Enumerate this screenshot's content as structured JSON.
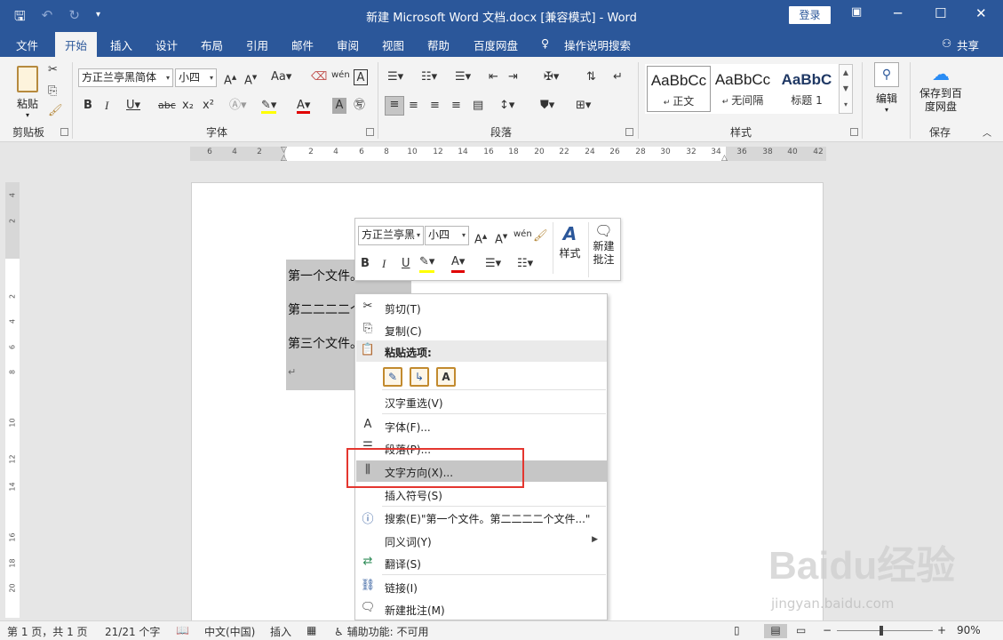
{
  "titlebar": {
    "title": "新建 Microsoft Word 文档.docx [兼容模式] - Word",
    "login": "登录"
  },
  "tabs": [
    "文件",
    "开始",
    "插入",
    "设计",
    "布局",
    "引用",
    "邮件",
    "审阅",
    "视图",
    "帮助",
    "百度网盘"
  ],
  "tell_me": "操作说明搜索",
  "share": "共享",
  "ribbon": {
    "clipboard": {
      "paste": "粘贴",
      "label": "剪贴板"
    },
    "font": {
      "font_name": "方正兰亭黑简体",
      "font_size": "小四",
      "label": "字体"
    },
    "paragraph": {
      "label": "段落"
    },
    "styles": {
      "label": "样式",
      "items": [
        {
          "preview": "AaBbCc",
          "name": "正文"
        },
        {
          "preview": "AaBbCc",
          "name": "无间隔"
        },
        {
          "preview": "AaBbC",
          "name": "标题 1"
        }
      ]
    },
    "editing": {
      "label": "编辑"
    },
    "save": {
      "button": "保存到百度网盘",
      "label": "保存"
    }
  },
  "ruler": {
    "ticks": [
      "6",
      "4",
      "2",
      "",
      "2",
      "4",
      "6",
      "8",
      "10",
      "12",
      "14",
      "16",
      "18",
      "20",
      "22",
      "24",
      "26",
      "28",
      "30",
      "32",
      "34",
      "36",
      "38",
      "40",
      "42"
    ]
  },
  "vruler": {
    "ticks": [
      "4",
      "2",
      "",
      "2",
      "4",
      "6",
      "8",
      "10",
      "12",
      "14",
      "16",
      "18",
      "20"
    ]
  },
  "document": {
    "lines": [
      "第一个文件。",
      "第二二二二个文件。",
      "第三个文件。"
    ],
    "paragraph_mark": "↵"
  },
  "minibar": {
    "font_name": "方正兰亭黑",
    "font_size": "小四",
    "styles": "样式",
    "new_comment": "新建批注"
  },
  "context_menu": {
    "items": [
      {
        "label": "剪切(T)",
        "icon": "scissors-icon"
      },
      {
        "label": "复制(C)",
        "icon": "copy-icon"
      },
      {
        "label": "粘贴选项:",
        "icon": "paste-icon"
      },
      {
        "label": "汉字重选(V)",
        "icon": ""
      },
      {
        "label": "字体(F)...",
        "icon": "font-icon"
      },
      {
        "label": "段落(P)...",
        "icon": "paragraph-icon"
      },
      {
        "label": "文字方向(X)...",
        "icon": "text-direction-icon"
      },
      {
        "label": "插入符号(S)",
        "icon": ""
      },
      {
        "label": "搜索(E)\"第一个文件。第二二二二个文件...\"",
        "icon": "search-info-icon"
      },
      {
        "label": "同义词(Y)",
        "icon": ""
      },
      {
        "label": "翻译(S)",
        "icon": "translate-icon"
      },
      {
        "label": "链接(I)",
        "icon": "link-icon"
      },
      {
        "label": "新建批注(M)",
        "icon": "new-comment-icon"
      }
    ]
  },
  "statusbar": {
    "page": "第 1 页，共 1 页",
    "words": "21/21 个字",
    "language": "中文(中国)",
    "mode": "插入",
    "accessibility": "辅助功能: 不可用",
    "zoom": "90%"
  },
  "watermark": {
    "text": "Baidu经验",
    "sub": "jingyan.baidu.com"
  },
  "colors": {
    "accent": "#2b579a",
    "highlight_box": "#e4362f",
    "selection": "#c8c8c8"
  }
}
